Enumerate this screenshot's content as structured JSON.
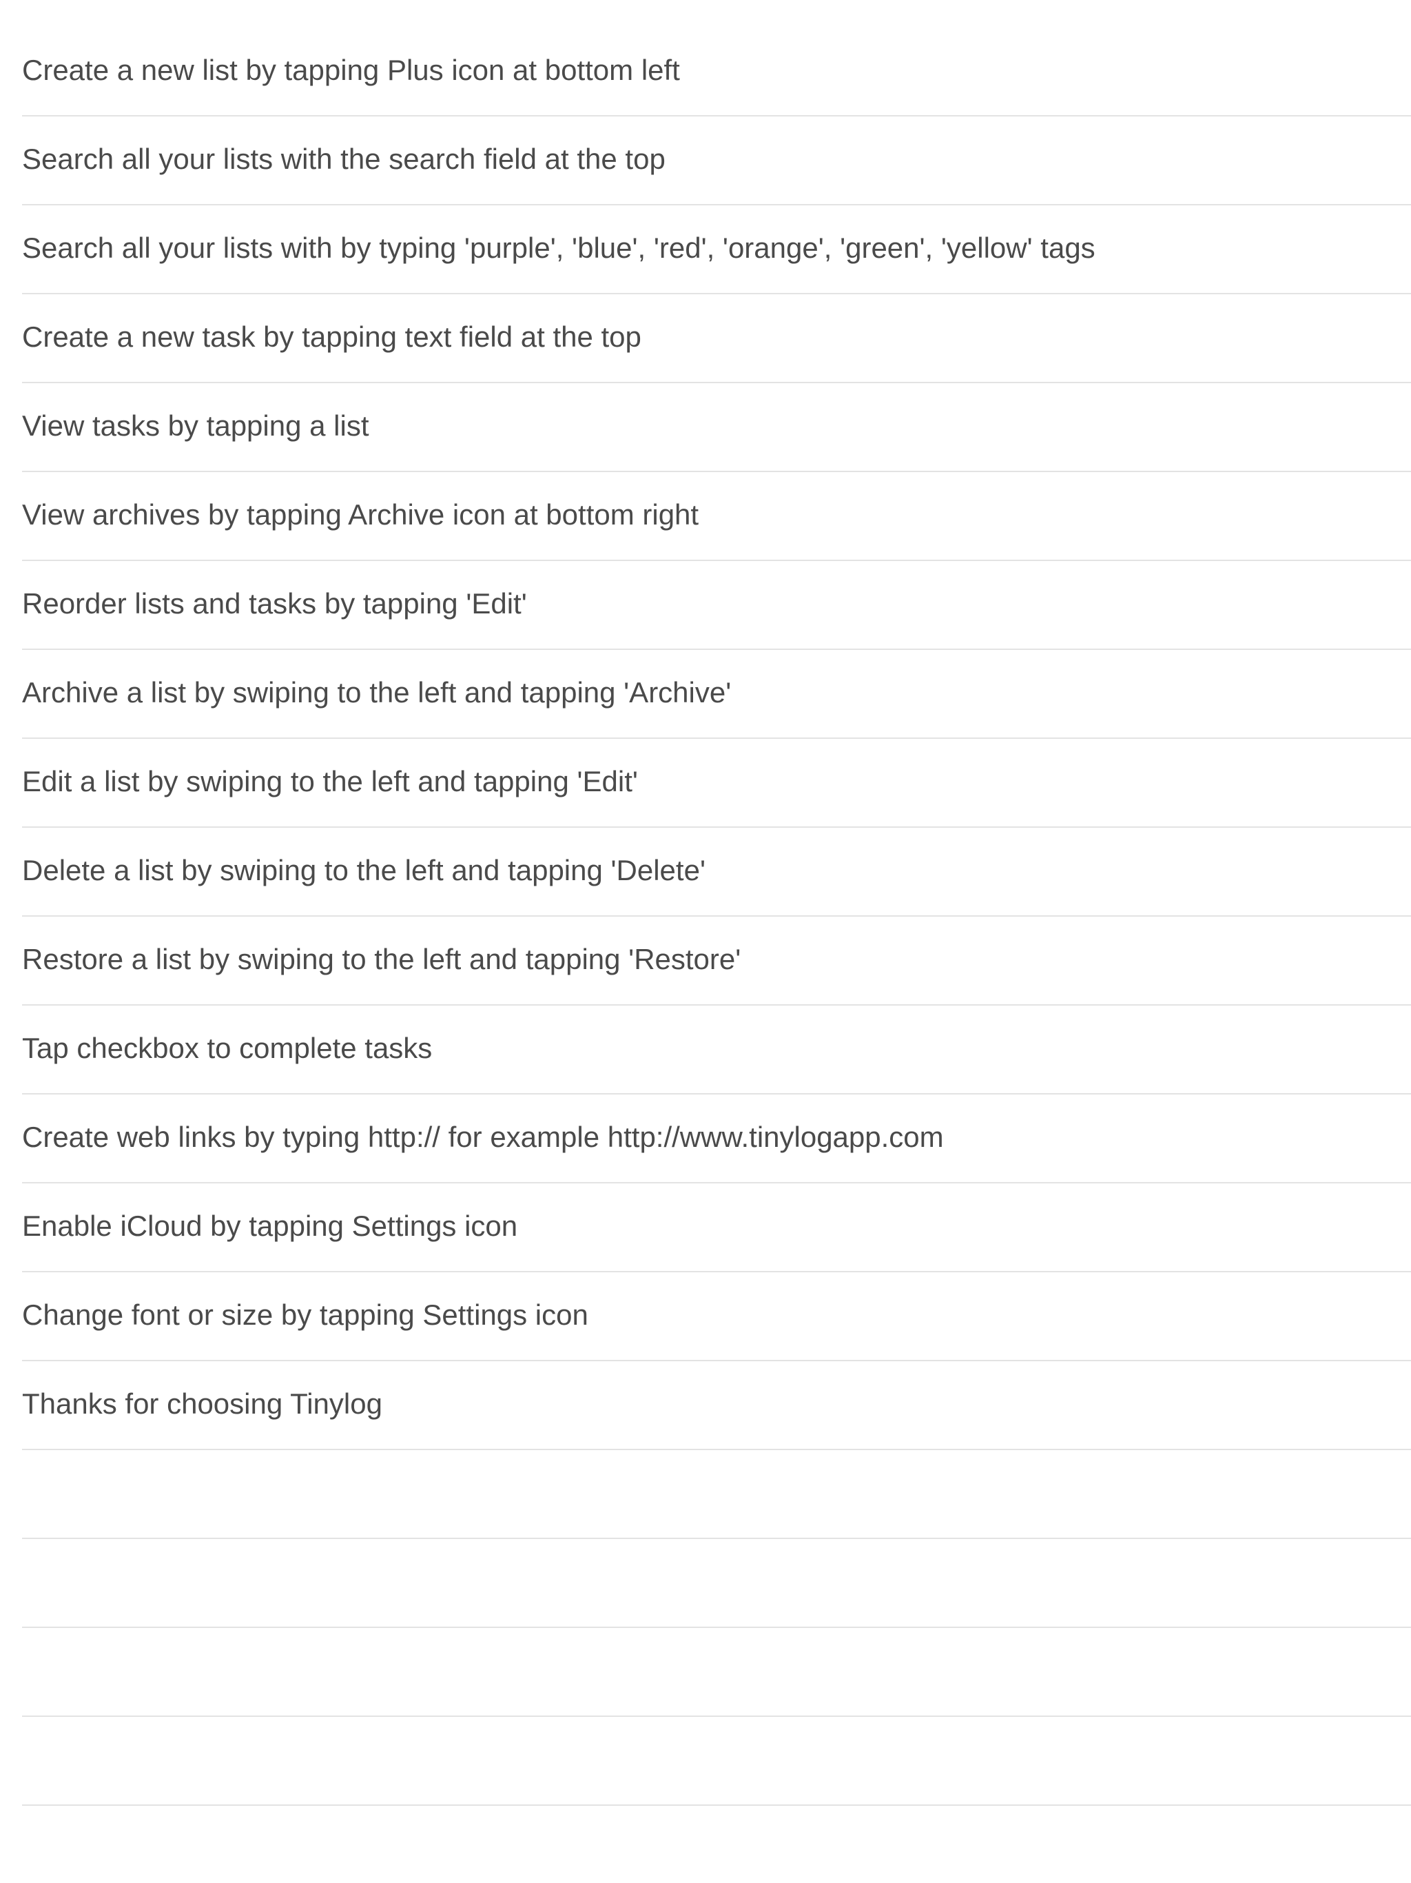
{
  "tips": [
    "Create a new list by tapping Plus icon at bottom left",
    "Search all your lists with the search field at the top",
    "Search all your lists with by typing 'purple', 'blue', 'red', 'orange', 'green', 'yellow' tags",
    "Create a new task by tapping text field at the top",
    "View tasks by tapping a list",
    "View archives by tapping Archive icon at bottom right",
    "Reorder lists and tasks by tapping 'Edit'",
    "Archive a list by swiping to the left and tapping 'Archive'",
    "Edit a list by swiping to the left and tapping 'Edit'",
    "Delete a list by swiping to the left and tapping 'Delete'",
    "Restore a list by swiping to the left and tapping 'Restore'",
    "Tap checkbox to complete tasks",
    "Create web links by typing http:// for example http://www.tinylogapp.com",
    "Enable iCloud by tapping Settings icon",
    "Change font or size by tapping Settings icon",
    "Thanks for choosing Tinylog",
    "",
    "",
    "",
    ""
  ],
  "colors": {
    "background": "#ffffff",
    "text": "#4a4a4a",
    "separator": "#e3e3e3"
  }
}
